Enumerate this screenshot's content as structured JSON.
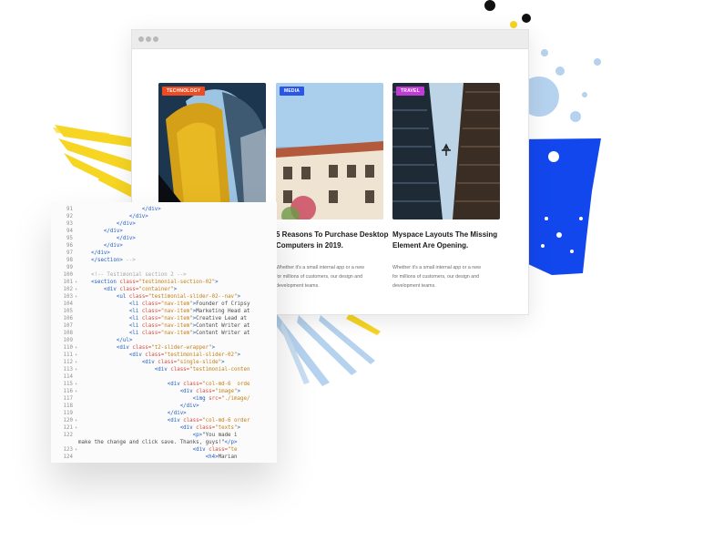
{
  "cards": [
    {
      "badge": "TECHNOLOGY",
      "badge_color": "#ef4b23",
      "title_lines": [],
      "desc_lines": []
    },
    {
      "badge": "MEDIA",
      "badge_color": "#2a55e5",
      "title_lines": [
        "5 Reasons To Purchase Desktop",
        "Computers in 2019."
      ],
      "desc_lines": [
        "Whether it's a small internal app or a new",
        "for millions of customers, our design and",
        "development teams."
      ]
    },
    {
      "badge": "TRAVEL",
      "badge_color": "#c13bd8",
      "title_lines": [
        "Myspace Layouts The Missing",
        "Element Are Opening."
      ],
      "desc_lines": [
        "Whether it's a small internal app or a new",
        "for millions of customers, our design and",
        "development teams."
      ]
    }
  ],
  "code_lines": [
    {
      "n": "91",
      "fold": "",
      "indent": "                    ",
      "parts": [
        [
          "tag",
          "</div>"
        ]
      ]
    },
    {
      "n": "92",
      "fold": "",
      "indent": "                ",
      "parts": [
        [
          "tag",
          "</div>"
        ]
      ]
    },
    {
      "n": "93",
      "fold": "",
      "indent": "            ",
      "parts": [
        [
          "tag",
          "</div>"
        ]
      ]
    },
    {
      "n": "94",
      "fold": "",
      "indent": "        ",
      "parts": [
        [
          "tag",
          "</div>"
        ]
      ]
    },
    {
      "n": "95",
      "fold": "",
      "indent": "            ",
      "parts": [
        [
          "tag",
          "</div>"
        ]
      ]
    },
    {
      "n": "96",
      "fold": "",
      "indent": "        ",
      "parts": [
        [
          "tag",
          "</div>"
        ]
      ]
    },
    {
      "n": "97",
      "fold": "",
      "indent": "    ",
      "parts": [
        [
          "tag",
          "</div>"
        ]
      ]
    },
    {
      "n": "98",
      "fold": "",
      "indent": "    ",
      "parts": [
        [
          "tag",
          "</section>"
        ],
        [
          "cmt",
          " -->"
        ]
      ]
    },
    {
      "n": "99",
      "fold": "",
      "indent": "",
      "parts": []
    },
    {
      "n": "100",
      "fold": "",
      "indent": "    ",
      "parts": [
        [
          "cmt",
          "<!-- Testimonial section 2 -->"
        ]
      ]
    },
    {
      "n": "101",
      "fold": "▾",
      "indent": "    ",
      "parts": [
        [
          "tag",
          "<section "
        ],
        [
          "attr",
          "class="
        ],
        [
          "str",
          "\"testimonial-section-02\""
        ],
        [
          "tag",
          ">"
        ]
      ]
    },
    {
      "n": "102",
      "fold": "▾",
      "indent": "        ",
      "parts": [
        [
          "tag",
          "<div "
        ],
        [
          "attr",
          "class="
        ],
        [
          "str",
          "\"container\""
        ],
        [
          "tag",
          ">"
        ]
      ]
    },
    {
      "n": "103",
      "fold": "▾",
      "indent": "            ",
      "parts": [
        [
          "tag",
          "<ul "
        ],
        [
          "attr",
          "class="
        ],
        [
          "str",
          "\"testimonial-slider-02--nav\""
        ],
        [
          "tag",
          ">"
        ]
      ]
    },
    {
      "n": "104",
      "fold": "",
      "indent": "                ",
      "parts": [
        [
          "tag",
          "<li "
        ],
        [
          "attr",
          "class="
        ],
        [
          "str",
          "\"nav-item\""
        ],
        [
          "tag",
          ">"
        ],
        [
          "plain",
          "Founder of Cripsy"
        ]
      ]
    },
    {
      "n": "105",
      "fold": "",
      "indent": "                ",
      "parts": [
        [
          "tag",
          "<li "
        ],
        [
          "attr",
          "class="
        ],
        [
          "str",
          "\"nav-item\""
        ],
        [
          "tag",
          ">"
        ],
        [
          "plain",
          "Marketing Head at"
        ]
      ]
    },
    {
      "n": "106",
      "fold": "",
      "indent": "                ",
      "parts": [
        [
          "tag",
          "<li "
        ],
        [
          "attr",
          "class="
        ],
        [
          "str",
          "\"nav-item\""
        ],
        [
          "tag",
          ">"
        ],
        [
          "plain",
          "Creative Lead at"
        ]
      ]
    },
    {
      "n": "107",
      "fold": "",
      "indent": "                ",
      "parts": [
        [
          "tag",
          "<li "
        ],
        [
          "attr",
          "class="
        ],
        [
          "str",
          "\"nav-item\""
        ],
        [
          "tag",
          ">"
        ],
        [
          "plain",
          "Content Writer at"
        ]
      ]
    },
    {
      "n": "108",
      "fold": "",
      "indent": "                ",
      "parts": [
        [
          "tag",
          "<li "
        ],
        [
          "attr",
          "class="
        ],
        [
          "str",
          "\"nav-item\""
        ],
        [
          "tag",
          ">"
        ],
        [
          "plain",
          "Content Writer at"
        ]
      ]
    },
    {
      "n": "109",
      "fold": "",
      "indent": "            ",
      "parts": [
        [
          "tag",
          "</ul>"
        ]
      ]
    },
    {
      "n": "110",
      "fold": "▾",
      "indent": "            ",
      "parts": [
        [
          "tag",
          "<div "
        ],
        [
          "attr",
          "class="
        ],
        [
          "str",
          "\"t2-slider-wrapper\""
        ],
        [
          "tag",
          ">"
        ]
      ]
    },
    {
      "n": "111",
      "fold": "▾",
      "indent": "                ",
      "parts": [
        [
          "tag",
          "<div "
        ],
        [
          "attr",
          "class="
        ],
        [
          "str",
          "\"testimonial-slider-02\""
        ],
        [
          "tag",
          ">"
        ]
      ]
    },
    {
      "n": "112",
      "fold": "▾",
      "indent": "                    ",
      "parts": [
        [
          "tag",
          "<div "
        ],
        [
          "attr",
          "class="
        ],
        [
          "str",
          "\"single-slide\""
        ],
        [
          "tag",
          ">"
        ]
      ]
    },
    {
      "n": "113",
      "fold": "▾",
      "indent": "                        ",
      "parts": [
        [
          "tag",
          "<div "
        ],
        [
          "attr",
          "class="
        ],
        [
          "str",
          "\"testimonial-conten"
        ]
      ]
    },
    {
      "n": "114",
      "fold": "",
      "indent": "",
      "parts": []
    },
    {
      "n": "115",
      "fold": "▾",
      "indent": "                            ",
      "parts": [
        [
          "tag",
          "<div "
        ],
        [
          "attr",
          "class="
        ],
        [
          "str",
          "\"col-md-6  orde"
        ]
      ]
    },
    {
      "n": "116",
      "fold": "▾",
      "indent": "                                ",
      "parts": [
        [
          "tag",
          "<div "
        ],
        [
          "attr",
          "class="
        ],
        [
          "str",
          "\"image\""
        ],
        [
          "tag",
          ">"
        ]
      ]
    },
    {
      "n": "117",
      "fold": "",
      "indent": "                                    ",
      "parts": [
        [
          "tag",
          "<img "
        ],
        [
          "attr",
          "src="
        ],
        [
          "str",
          "\"./image/"
        ]
      ]
    },
    {
      "n": "118",
      "fold": "",
      "indent": "                                ",
      "parts": [
        [
          "tag",
          "</div>"
        ]
      ]
    },
    {
      "n": "119",
      "fold": "",
      "indent": "                            ",
      "parts": [
        [
          "tag",
          "</div>"
        ]
      ]
    },
    {
      "n": "120",
      "fold": "▾",
      "indent": "                            ",
      "parts": [
        [
          "tag",
          "<div "
        ],
        [
          "attr",
          "class="
        ],
        [
          "str",
          "\"col-md-6 order"
        ]
      ]
    },
    {
      "n": "121",
      "fold": "▾",
      "indent": "                                ",
      "parts": [
        [
          "tag",
          "<div "
        ],
        [
          "attr",
          "class="
        ],
        [
          "str",
          "\"texts\""
        ],
        [
          "tag",
          ">"
        ]
      ]
    },
    {
      "n": "122",
      "fold": "",
      "indent": "                                    ",
      "parts": [
        [
          "tag",
          "<p>"
        ],
        [
          "plain",
          "\"You made i"
        ]
      ]
    },
    {
      "n": "",
      "fold": "",
      "indent": "make the change and click save. Thanks, guys!\"",
      "parts": [
        [
          "tag",
          "</p>"
        ]
      ]
    },
    {
      "n": "123",
      "fold": "▾",
      "indent": "                                    ",
      "parts": [
        [
          "tag",
          "<div "
        ],
        [
          "attr",
          "class="
        ],
        [
          "str",
          "\"te"
        ]
      ]
    },
    {
      "n": "124",
      "fold": "",
      "indent": "                                        ",
      "parts": [
        [
          "tag",
          "<h4>"
        ],
        [
          "plain",
          "Marian"
        ]
      ]
    }
  ]
}
